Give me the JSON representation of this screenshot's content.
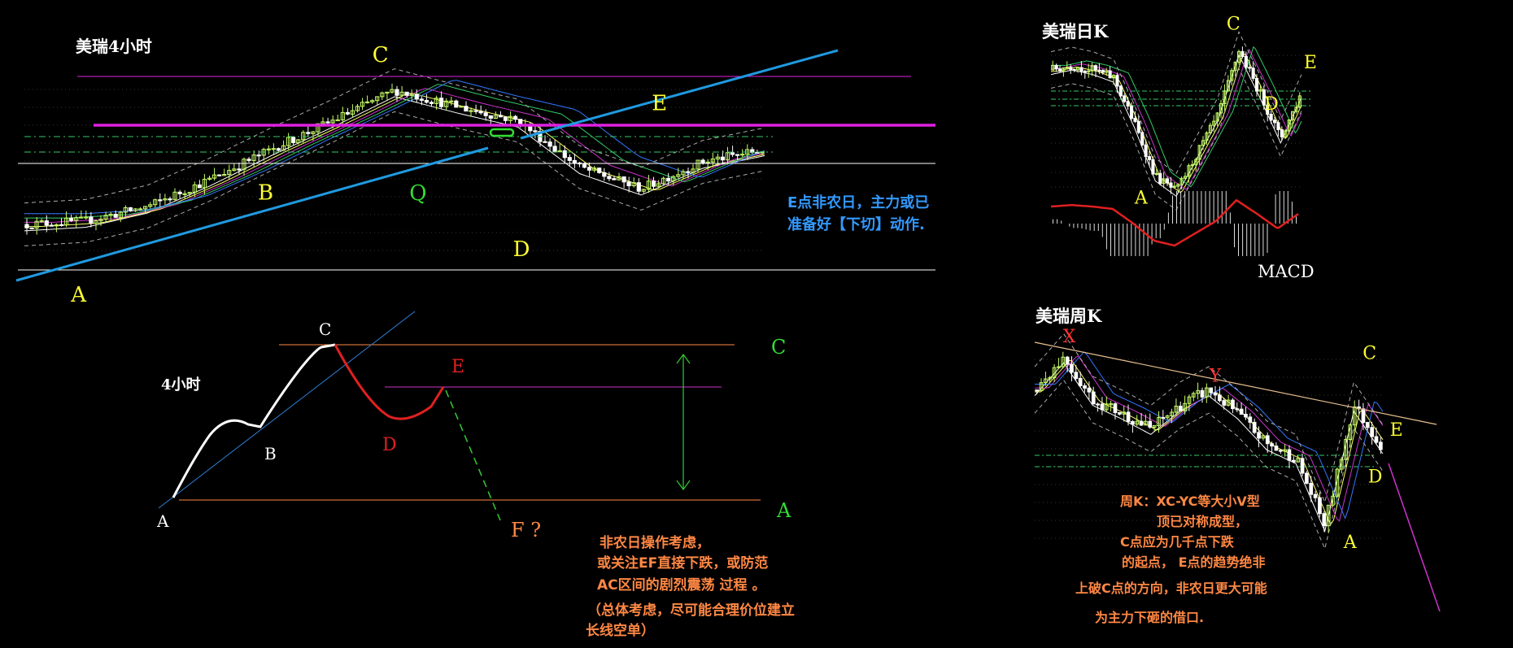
{
  "colors": {
    "background": "#000000",
    "yellow_label": "#ffff33",
    "green_label": "#33dd33",
    "blue_note": "#3399ff",
    "orange_note": "#ff8844",
    "trendline_blue": "#1f9ae0",
    "magenta_line": "#e020e0",
    "red_path": "#e02020",
    "white_line": "#ffffff",
    "candle_up": "#c8ff66",
    "candle_down": "#ffffff"
  },
  "chart_data": [
    {
      "id": "h4",
      "type": "candlestick",
      "title": "美瑞4小时",
      "points": [
        {
          "label": "A",
          "x": 0.03,
          "price": 0.04
        },
        {
          "label": "B",
          "x": 0.3,
          "price": 0.42
        },
        {
          "label": "C",
          "x": 0.47,
          "price": 0.95
        },
        {
          "label": "Q",
          "x": 0.52,
          "price": 0.6
        },
        {
          "label": "D",
          "x": 0.66,
          "price": 0.35
        },
        {
          "label": "E",
          "x": 0.82,
          "price": 0.62
        }
      ],
      "note": [
        "E点非农日，主力或已",
        "准备好【下切】动作."
      ],
      "trend": [
        0.2,
        0.22,
        0.3,
        0.45,
        0.62,
        0.78,
        0.95,
        0.86,
        0.78,
        0.52,
        0.4,
        0.55,
        0.62
      ]
    },
    {
      "id": "daily",
      "type": "candlestick",
      "title": "美瑞日K",
      "points": [
        {
          "label": "A",
          "x": 0.36,
          "price": 0.05
        },
        {
          "label": "C",
          "x": 0.74,
          "price": 0.98
        },
        {
          "label": "D",
          "x": 0.89,
          "price": 0.4
        },
        {
          "label": "E",
          "x": 0.99,
          "price": 0.7
        }
      ],
      "indicator": "MACD",
      "trend": [
        0.85,
        0.88,
        0.85,
        0.8,
        0.5,
        0.15,
        0.05,
        0.3,
        0.55,
        0.98,
        0.7,
        0.4,
        0.7
      ]
    },
    {
      "id": "weekly",
      "type": "candlestick",
      "title": "美瑞周K",
      "points": [
        {
          "label": "X",
          "x": 0.1,
          "price": 0.97
        },
        {
          "label": "Y",
          "x": 0.52,
          "price": 0.8
        },
        {
          "label": "C",
          "x": 0.97,
          "price": 0.72
        },
        {
          "label": "E",
          "x": 1.02,
          "price": 0.5
        },
        {
          "label": "D",
          "x": 0.99,
          "price": 0.3
        },
        {
          "label": "A",
          "x": 0.92,
          "price": 0.1
        }
      ],
      "note": [
        "周K：XC-YC等大小V型",
        "顶已对称成型，",
        "C点应为几千点下跌",
        "的起点， E点的趋势绝非",
        "上破C点的方向，非农日更大可能",
        "为主力下砸的借口."
      ],
      "trend": [
        0.8,
        0.97,
        0.75,
        0.68,
        0.6,
        0.72,
        0.8,
        0.68,
        0.52,
        0.45,
        0.1,
        0.72,
        0.5
      ]
    },
    {
      "id": "schematic",
      "type": "diagram",
      "title": "4小时",
      "points": [
        {
          "label": "A",
          "x": 0.0,
          "price": 0.0
        },
        {
          "label": "B",
          "x": 0.17,
          "price": 0.47
        },
        {
          "label": "C",
          "x": 0.3,
          "price": 1.0
        },
        {
          "label": "D",
          "x": 0.4,
          "price": 0.5
        },
        {
          "label": "E",
          "x": 0.48,
          "price": 0.73
        },
        {
          "label": "F ?",
          "x": 0.6,
          "price": -0.15
        }
      ],
      "level_labels": [
        "C",
        "A"
      ],
      "note": [
        "非农日操作考虑，",
        "或关注EF直接下跌，或防范",
        "AC区间的剧烈震荡 过程 。"
      ],
      "note2": [
        "（总体考虑，尽可能合理价位建立",
        "长线空单）"
      ]
    }
  ]
}
